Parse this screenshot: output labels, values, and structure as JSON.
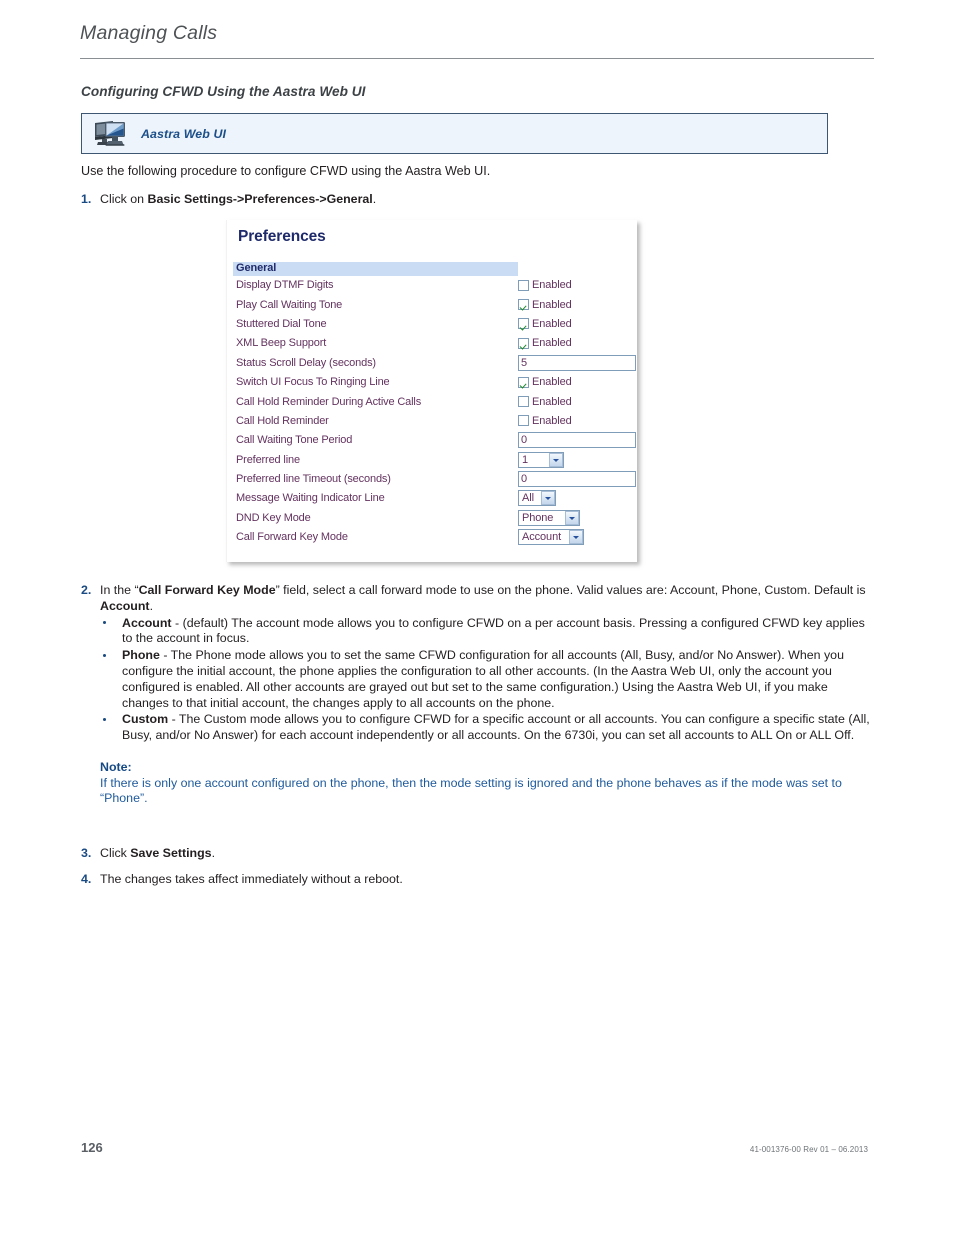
{
  "header": {
    "running_title": "Managing Calls",
    "section_heading": "Configuring CFWD Using the Aastra Web UI"
  },
  "callout": {
    "icon": "desktop-computer-icon",
    "label": "Aastra Web UI",
    "background": "#eef4fb",
    "border_color": "#3d5672",
    "label_color": "#1b4f8a"
  },
  "intro": "Use the following procedure to configure CFWD using the Aastra Web UI.",
  "steps": {
    "step1": {
      "num": "1.",
      "prefix": "Click on ",
      "bold": "Basic Settings->Preferences->General",
      "suffix": "."
    },
    "step2": {
      "num": "2.",
      "lead_part1": "In the “",
      "lead_bold1": "Call Forward Key Mode",
      "lead_part2": "” field, select a call forward mode to use on the phone. Valid values are: Account, Phone, Custom. Default is ",
      "lead_bold2": "Account",
      "lead_part3": ".",
      "bullets": [
        {
          "term": "Account",
          "text": " - (default) The account mode allows you to configure CFWD on a per account basis. Pressing a configured CFWD key applies to the account in focus."
        },
        {
          "term": "Phone",
          "text": " - The Phone mode allows you to set the same CFWD configuration for all accounts (All, Busy, and/or No Answer). When you configure the initial account, the phone applies the configuration to all other accounts. (In the Aastra Web UI, only the account you configured is enabled. All other accounts are grayed out but set to the same configuration.) Using the Aastra Web UI, if you make changes to that initial account, the changes apply to all accounts on the phone."
        },
        {
          "term": "Custom",
          "text": " - The Custom mode allows you to configure CFWD for a specific account or all accounts. You can configure a specific state (All, Busy, and/or No Answer) for each account independently or all accounts. On the 6730i, you can set all accounts to ALL On or ALL Off."
        }
      ],
      "note": {
        "title": "Note:",
        "text": "If there is only one account configured on the phone, then the mode setting is ignored and the phone behaves as if the mode was set to “Phone”.",
        "color": "#1e5a9c"
      }
    },
    "step3": {
      "num": "3.",
      "prefix": "Click ",
      "bold": "Save Settings",
      "suffix": "."
    },
    "step4": {
      "num": "4.",
      "text": "The changes takes affect immediately without a reboot."
    }
  },
  "screenshot": {
    "title": "Preferences",
    "title_color": "#1f2a6b",
    "group_header": "General",
    "group_header_bg": "#c9dcf3",
    "label_color": "#63325f",
    "checkbox_check_color": "#1f8a2e",
    "enabled_label": "Enabled",
    "rows": [
      {
        "label": "Display DTMF Digits",
        "control": "checkbox",
        "checked": false,
        "value": "Enabled"
      },
      {
        "label": "Play Call Waiting Tone",
        "control": "checkbox",
        "checked": true,
        "value": "Enabled"
      },
      {
        "label": "Stuttered Dial Tone",
        "control": "checkbox",
        "checked": true,
        "value": "Enabled"
      },
      {
        "label": "XML Beep Support",
        "control": "checkbox",
        "checked": true,
        "value": "Enabled"
      },
      {
        "label": "Status Scroll Delay (seconds)",
        "control": "text",
        "value": "5"
      },
      {
        "label": "Switch UI Focus To Ringing Line",
        "control": "checkbox",
        "checked": true,
        "value": "Enabled"
      },
      {
        "label": "Call Hold Reminder During Active Calls",
        "control": "checkbox",
        "checked": false,
        "value": "Enabled"
      },
      {
        "label": "Call Hold Reminder",
        "control": "checkbox",
        "checked": false,
        "value": "Enabled"
      },
      {
        "label": "Call Waiting Tone Period",
        "control": "text",
        "value": "0"
      },
      {
        "label": "Preferred line",
        "control": "select",
        "value": "1",
        "width": "w-small"
      },
      {
        "label": "Preferred line Timeout (seconds)",
        "control": "text",
        "value": "0"
      },
      {
        "label": "Message Waiting Indicator Line",
        "control": "select",
        "value": "All",
        "width": "w-narrow"
      },
      {
        "label": "DND Key Mode",
        "control": "select",
        "value": "Phone",
        "width": "w-med"
      },
      {
        "label": "Call Forward Key Mode",
        "control": "select",
        "value": "Account",
        "width": "w-wide"
      }
    ]
  },
  "footer": {
    "page_number": "126",
    "document_id": "41-001376-00 Rev 01 – 06.2013"
  }
}
